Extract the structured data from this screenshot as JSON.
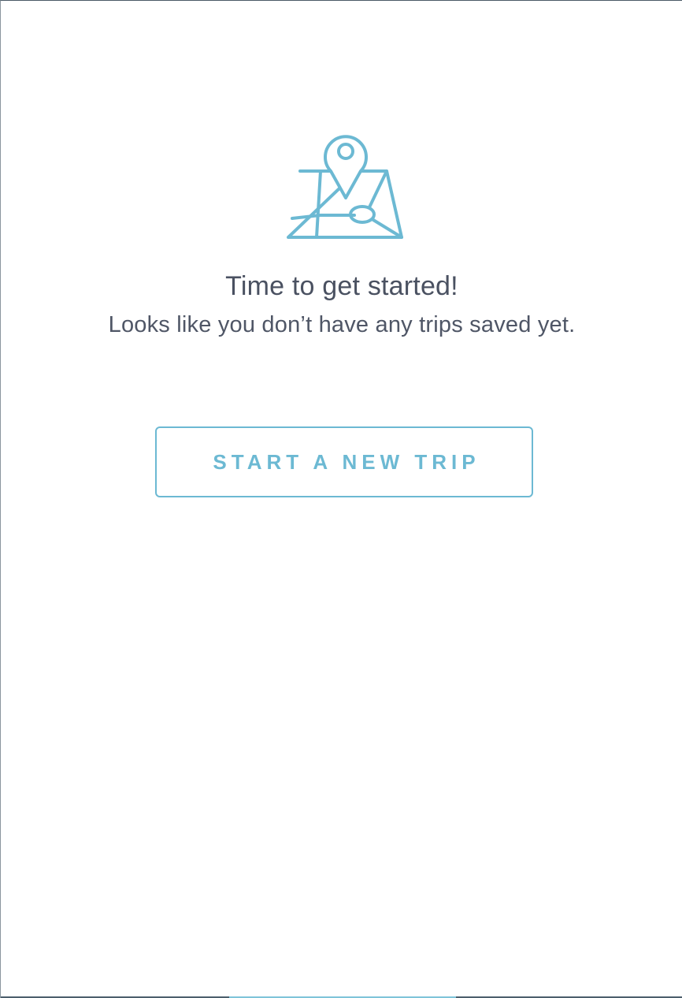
{
  "empty_state": {
    "icon": "map-pin-icon",
    "title": "Time to get started!",
    "subtitle": "Looks like you don’t have any trips saved yet.",
    "button_label": "START A NEW TRIP"
  },
  "colors": {
    "accent": "#6cb9d3",
    "text_primary": "#4a5161",
    "text_secondary": "#4f5666",
    "background": "#ffffff"
  }
}
